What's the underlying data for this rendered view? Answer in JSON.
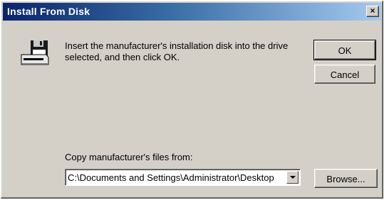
{
  "window": {
    "title": "Install From Disk",
    "close_glyph": "×"
  },
  "message": {
    "text": "Insert the manufacturer's installation disk into the drive selected, and then click OK."
  },
  "buttons": {
    "ok": "OK",
    "cancel": "Cancel",
    "browse": "Browse..."
  },
  "copy": {
    "label": "Copy manufacturer's files from:",
    "path": "C:\\Documents and Settings\\Administrator\\Desktop"
  },
  "icons": {
    "disk": "floppy-disk-drive-icon",
    "dropdown": "chevron-down-icon"
  },
  "colors": {
    "dialog_bg": "#d4d0c8",
    "titlebar_start": "#0a246a",
    "titlebar_end": "#a6caf0"
  }
}
